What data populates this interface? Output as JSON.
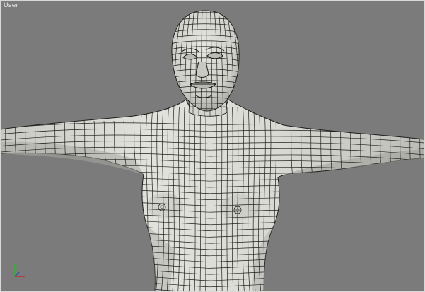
{
  "viewport": {
    "label": "User",
    "background": "#7b7b7b"
  },
  "model": {
    "skin_color": "#dcdcd6",
    "shade_color": "#a9a9a3",
    "wire_color": "#1e1e1e"
  },
  "axis_gizmo": {
    "axes": [
      "x",
      "y",
      "z"
    ],
    "colors": {
      "x": "#d22020",
      "y": "#1fbf1f",
      "z": "#2a45e0"
    }
  }
}
